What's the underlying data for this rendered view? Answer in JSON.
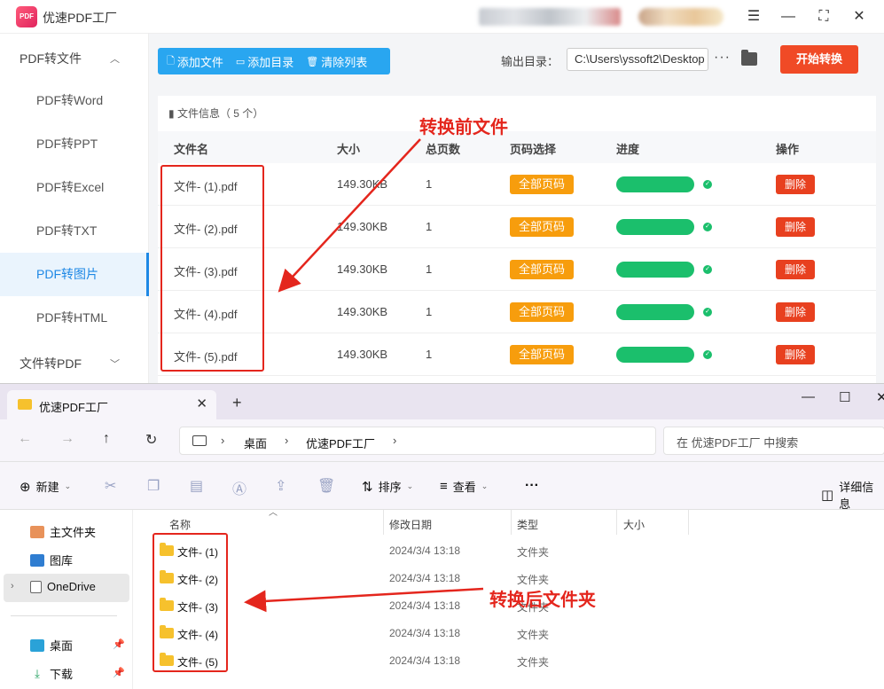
{
  "app": {
    "title": "优速PDF工厂",
    "logo_text": "PDF",
    "win_controls": {
      "menu": "☰",
      "minimize": "—",
      "maximize": "⛶",
      "close": "✕"
    }
  },
  "sidebar": {
    "group1": "PDF转文件",
    "group1_chev": "︿",
    "items": [
      "PDF转Word",
      "PDF转PPT",
      "PDF转Excel",
      "PDF转TXT",
      "PDF转图片",
      "PDF转HTML"
    ],
    "active_index": 4,
    "group2": "文件转PDF",
    "group2_chev": "﹀"
  },
  "toolbar": {
    "add_file": "添加文件",
    "add_dir": "添加目录",
    "clear_list": "清除列表",
    "output_label": "输出目录：",
    "output_path": "C:\\Users\\yssoft2\\Desktop",
    "more": "···",
    "start": "开始转换"
  },
  "file_table": {
    "info": "文件信息（ 5 个）",
    "headers": {
      "name": "文件名",
      "size": "大小",
      "pages": "总页数",
      "page_select": "页码选择",
      "progress": "进度",
      "action": "操作"
    },
    "rows": [
      {
        "name": "文件- (1).pdf",
        "size": "149.30KB",
        "pages": "1",
        "page_select": "全部页码",
        "progress": 1.0,
        "action": "删除"
      },
      {
        "name": "文件- (2).pdf",
        "size": "149.30KB",
        "pages": "1",
        "page_select": "全部页码",
        "progress": 1.0,
        "action": "删除"
      },
      {
        "name": "文件- (3).pdf",
        "size": "149.30KB",
        "pages": "1",
        "page_select": "全部页码",
        "progress": 1.0,
        "action": "删除"
      },
      {
        "name": "文件- (4).pdf",
        "size": "149.30KB",
        "pages": "1",
        "page_select": "全部页码",
        "progress": 1.0,
        "action": "删除"
      },
      {
        "name": "文件- (5).pdf",
        "size": "149.30KB",
        "pages": "1",
        "page_select": "全部页码",
        "progress": 1.0,
        "action": "删除"
      }
    ]
  },
  "annotations": {
    "before": "转换前文件",
    "after": "转换后文件夹",
    "color": "#e4261d"
  },
  "explorer": {
    "tab_title": "优速PDF工厂",
    "tab_close": "✕",
    "new_tab": "+",
    "win_controls": {
      "minimize": "—",
      "maximize": "☐",
      "close": "✕"
    },
    "nav": {
      "back": "←",
      "forward": "→",
      "up": "↑",
      "refresh": "↻"
    },
    "breadcrumb": [
      "桌面",
      "优速PDF工厂"
    ],
    "crumb_sep": "›",
    "search_placeholder": "在 优速PDF工厂 中搜索",
    "cmd": {
      "new": "新建",
      "sort": "排序",
      "view": "查看",
      "more": "···",
      "details": "详细信息"
    },
    "nav_items": {
      "home": "主文件夹",
      "gallery": "图库",
      "onedrive": "OneDrive",
      "desktop": "桌面",
      "downloads": "下载"
    },
    "columns": {
      "name": "名称",
      "modified": "修改日期",
      "type": "类型",
      "size": "大小"
    },
    "sort_indicator": "︿",
    "rows": [
      {
        "name": "文件- (1)",
        "modified": "2024/3/4 13:18",
        "type": "文件夹"
      },
      {
        "name": "文件- (2)",
        "modified": "2024/3/4 13:18",
        "type": "文件夹"
      },
      {
        "name": "文件- (3)",
        "modified": "2024/3/4 13:18",
        "type": "文件夹"
      },
      {
        "name": "文件- (4)",
        "modified": "2024/3/4 13:18",
        "type": "文件夹"
      },
      {
        "name": "文件- (5)",
        "modified": "2024/3/4 13:18",
        "type": "文件夹"
      }
    ]
  }
}
